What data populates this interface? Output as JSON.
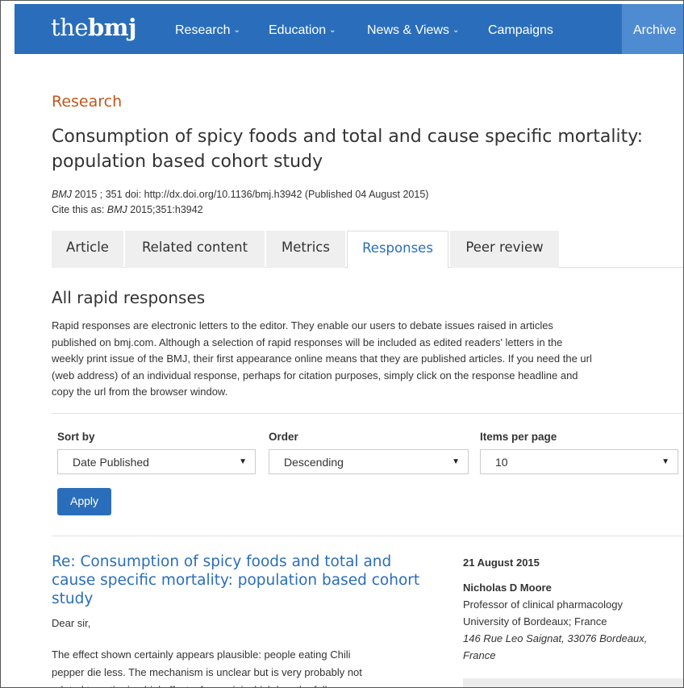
{
  "nav": {
    "logo_light": "the",
    "logo_bold": "bmj",
    "items": [
      {
        "label": "Research",
        "has_caret": true
      },
      {
        "label": "Education",
        "has_caret": true
      },
      {
        "label": "News & Views",
        "has_caret": true
      },
      {
        "label": "Campaigns",
        "has_caret": false
      }
    ],
    "archive": "Archive",
    "caret": "⌄"
  },
  "article": {
    "section": "Research",
    "title": "Consumption of spicy foods and total and cause specific mortality: population based cohort study",
    "citation": {
      "journal": "BMJ",
      "details": " 2015 ; 351  doi: http://dx.doi.org/10.1136/bmj.h3942 (Published 04 August 2015)",
      "cite_prefix": "Cite this as: ",
      "cite_journal": "BMJ",
      "cite_ref": " 2015;351:h3942"
    }
  },
  "tabs": [
    {
      "label": "Article",
      "active": false
    },
    {
      "label": "Related content",
      "active": false
    },
    {
      "label": "Metrics",
      "active": false
    },
    {
      "label": "Responses",
      "active": true
    },
    {
      "label": "Peer review",
      "active": false
    }
  ],
  "responses": {
    "heading": "All rapid responses",
    "intro_lines": [
      "Rapid responses are electronic letters to the editor. They enable our users to debate issues raised in articles",
      "published on bmj.com. Although a selection of rapid responses will be included as edited readers' letters in the",
      "weekly print issue of the BMJ, their first appearance online means that they are published articles. If you need the url",
      "(web address) of an individual response, perhaps for citation purposes, simply click on the response headline and",
      "copy the url from the browser window."
    ],
    "filters": {
      "sort_label": "Sort by",
      "sort_value": "Date Published",
      "order_label": "Order",
      "order_value": "Descending",
      "items_label": "Items per page",
      "items_value": "10",
      "arrow": "▼",
      "apply": "Apply"
    },
    "first": {
      "title": "Re: Consumption of spicy foods and total and cause specific mortality: population based cohort study",
      "salutation": "Dear sir,",
      "body_lines": [
        "The effect shown certainly appears plausible: people eating Chili",
        "pepper die less. The mechanism is unclear but is very probably not",
        "related to anti-microbial effects, for a mini-which has the full"
      ],
      "date": "21 August 2015",
      "author": "Nicholas D Moore",
      "role": "Professor of clinical pharmacology",
      "affiliation": "University of Bordeaux; France",
      "address_line1": "146 Rue Leo Saignat, 33076 Bordeaux,",
      "address_line2": "France"
    }
  }
}
